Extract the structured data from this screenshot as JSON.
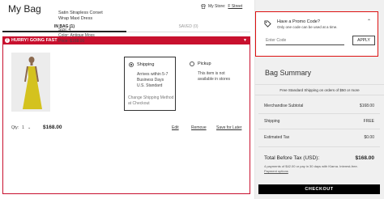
{
  "header": {
    "title": "My Bag",
    "store_label": "My Store:",
    "store_name": "F Street"
  },
  "tabs": [
    {
      "label": "IN BAG (1)",
      "active": true
    },
    {
      "label": "SAVED (0)",
      "active": false
    }
  ],
  "alert": {
    "text": "HURRY! GOING FAST",
    "color": "#c8102e"
  },
  "item": {
    "name": "Satin Strapless Corset Wrap Maxi Dress",
    "size": "Size: 4",
    "color": "Color: Antique Moss",
    "price_each": "Price: $168.00",
    "qty_label": "Qty:",
    "qty_value": "1",
    "total": "$168.00",
    "actions": {
      "edit": "Edit",
      "remove": "Remove",
      "save": "Save for Later"
    }
  },
  "shipping_option": {
    "label": "Shipping",
    "selected": true,
    "lines": [
      "Arrives within 5-7",
      "Business Days",
      "U.S. Standard"
    ],
    "change_line1": "Change Shipping Method",
    "change_line2": "at Checkout"
  },
  "pickup_option": {
    "label": "Pickup",
    "selected": false,
    "lines": [
      "This item is not",
      "available in stores"
    ]
  },
  "promo": {
    "title": "Have a Promo Code?",
    "subtitle": "Only one code can be used at a time.",
    "placeholder": "Enter Code",
    "apply_label": "APPLY"
  },
  "summary": {
    "title": "Bag Summary",
    "free_shipping": "Free Standard Shipping on orders of $50 or more",
    "merchandise_label": "Merchandise Subtotal",
    "merchandise_value": "$168.00",
    "shipping_label": "Shipping",
    "shipping_value": "FREE",
    "tax_label": "Estimated Tax",
    "tax_value": "$0.00",
    "total_label": "Total Before Tax (USD):",
    "total_value": "$168.00",
    "klarna_line1": "4 payments of $42.00 or pay in 30 days with Klarna. Interest-free.",
    "klarna_line2": "Payment options",
    "checkout_label": "CHECKOUT"
  }
}
